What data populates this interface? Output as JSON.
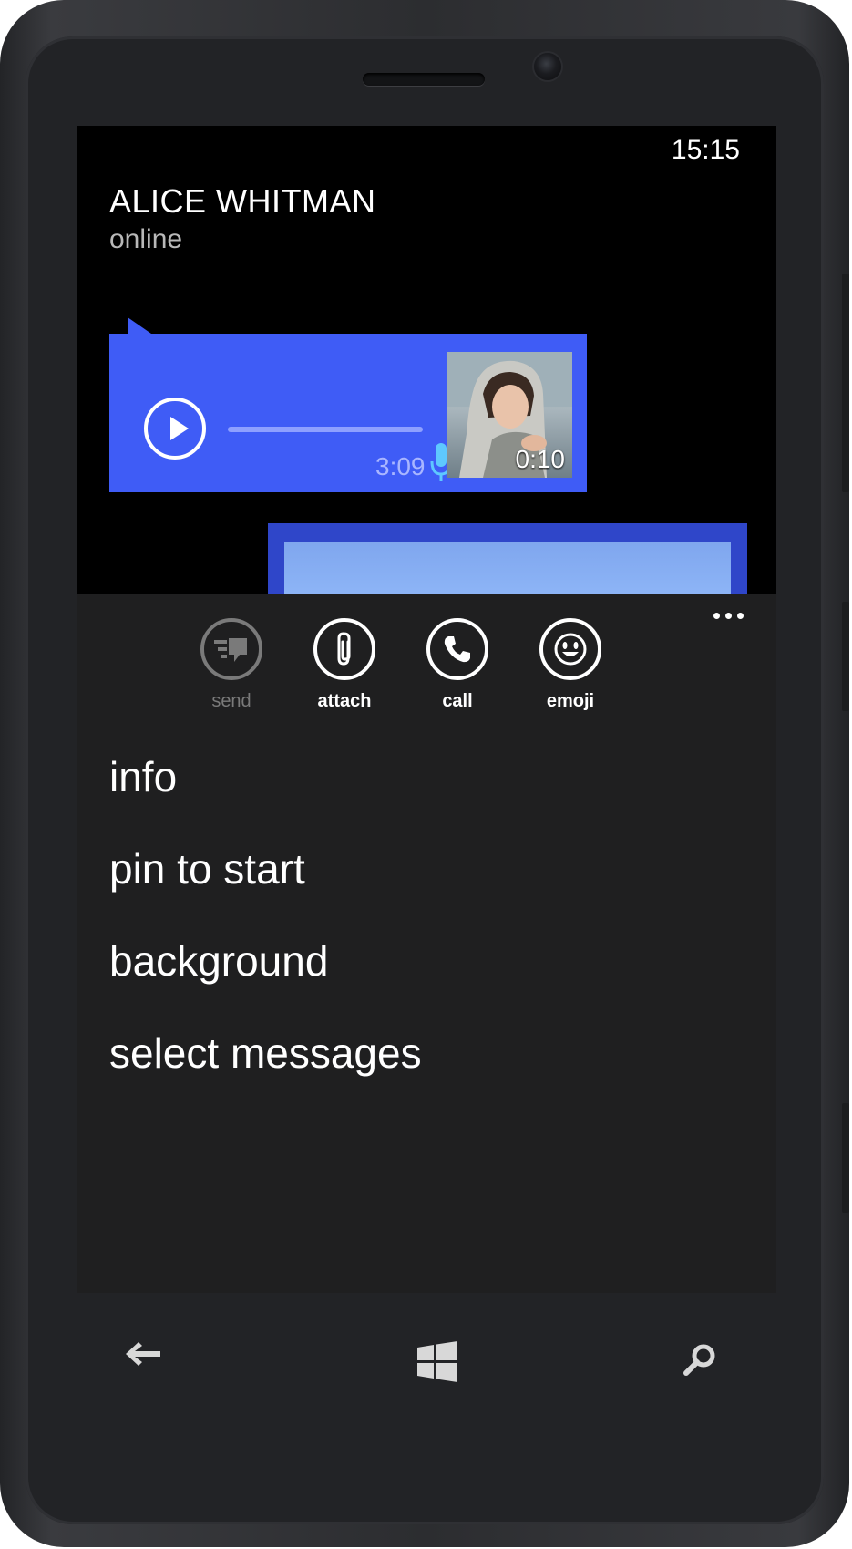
{
  "status_bar": {
    "time": "15:15"
  },
  "conversation": {
    "contact_name": "ALICE WHITMAN",
    "status": "online",
    "voice_message": {
      "duration": "3:09",
      "video_duration": "0:10"
    }
  },
  "app_bar": {
    "buttons": [
      {
        "label": "send",
        "icon": "send-icon",
        "enabled": false
      },
      {
        "label": "attach",
        "icon": "paperclip-icon",
        "enabled": true
      },
      {
        "label": "call",
        "icon": "phone-icon",
        "enabled": true
      },
      {
        "label": "emoji",
        "icon": "smiley-icon",
        "enabled": true
      }
    ],
    "menu_items": [
      {
        "label": "info"
      },
      {
        "label": "pin to start"
      },
      {
        "label": "background"
      },
      {
        "label": "select messages"
      }
    ]
  },
  "hardware_keys": [
    "back-arrow-icon",
    "windows-logo-icon",
    "search-icon"
  ],
  "colors": {
    "bubble": "#3f5cf6",
    "appbar": "#1f1f20",
    "screen": "#000000"
  }
}
